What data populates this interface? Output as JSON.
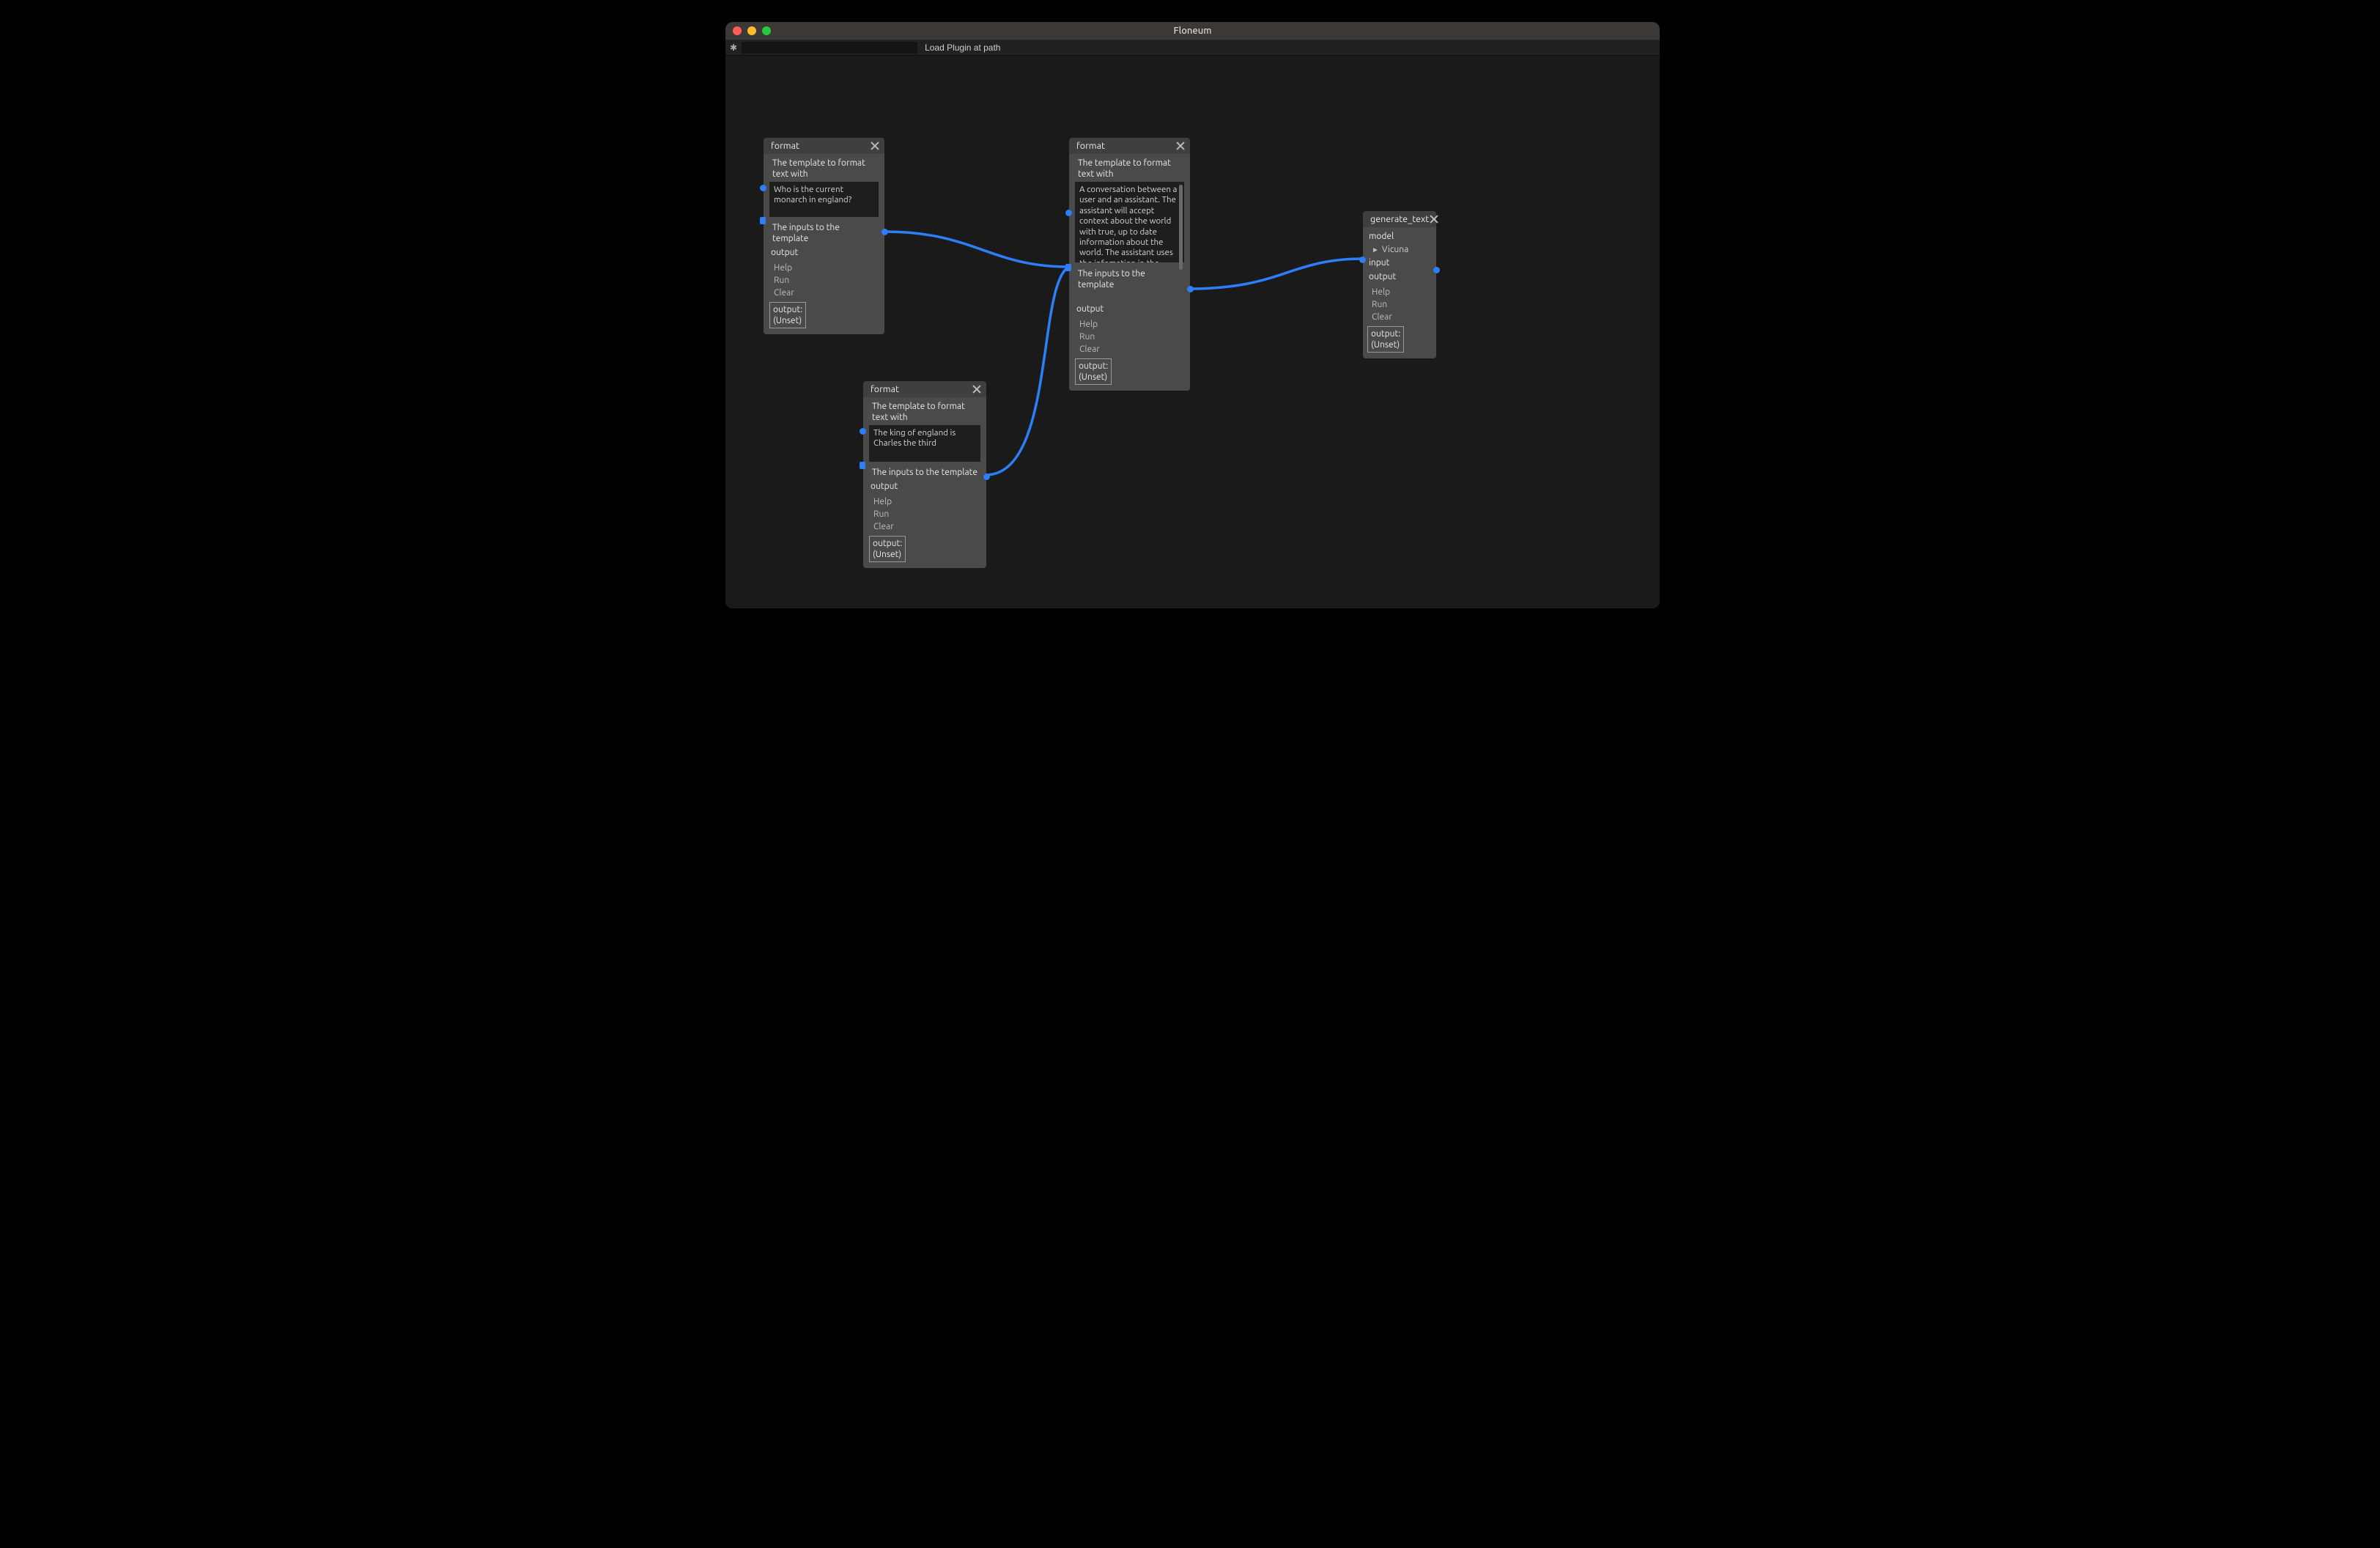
{
  "window": {
    "title": "Floneum"
  },
  "toolbar": {
    "icon": "✱",
    "path_value": "",
    "load_button": "Load Plugin at path"
  },
  "labels": {
    "template_desc": "The template to format text with",
    "inputs_desc": "The inputs to the template",
    "output": "output",
    "help": "Help",
    "run": "Run",
    "clear": "Clear",
    "output_box_label": "output:",
    "unset": "(Unset)",
    "model": "model",
    "input": "input"
  },
  "nodes": {
    "format1": {
      "title": "format",
      "text": "Who is the current monarch in england?"
    },
    "format2": {
      "title": "format",
      "text": "A conversation between a user and an assistant. The assistant will accept context about the world with true, up to date information about the world. The assistant uses the infomation in the context to answer susinctly"
    },
    "format3": {
      "title": "format",
      "text": "The king of england is Charles the third"
    },
    "generate": {
      "title": "generate_text",
      "model_value": "Vicuna"
    }
  },
  "wire_color": "#2d7ff9"
}
